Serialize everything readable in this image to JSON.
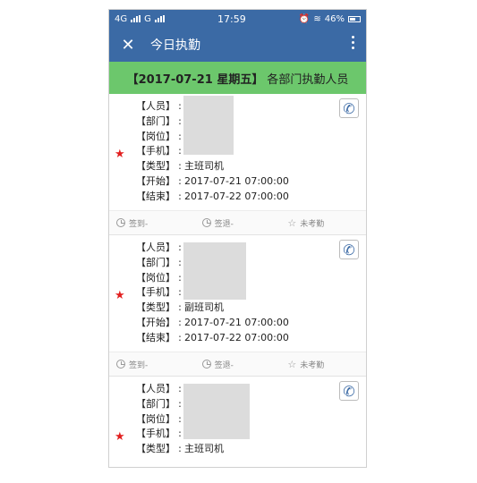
{
  "status": {
    "network_left": "4G",
    "network_right": "G",
    "time": "17:59",
    "battery": "46%"
  },
  "appbar": {
    "title": "今日执勤"
  },
  "banner": {
    "date_text": "【2017-07-21 星期五】",
    "suffix": "各部门执勤人员"
  },
  "labels": {
    "person": "【人员】",
    "dept": "【部门】",
    "post": "【岗位】",
    "mobile": "【手机】",
    "type": "【类型】",
    "start": "【开始】",
    "end": "【结束】",
    "sep": ":"
  },
  "cards": [
    {
      "type": "主班司机",
      "start": "2017-07-21 07:00:00",
      "end": "2017-07-22 07:00:00"
    },
    {
      "type": "副班司机",
      "start": "2017-07-21 07:00:00",
      "end": "2017-07-22 07:00:00"
    },
    {
      "type": "主班司机"
    }
  ],
  "actions": {
    "sign_in": "签到-",
    "sign_out": "签退-",
    "attendance": "未考勤"
  }
}
